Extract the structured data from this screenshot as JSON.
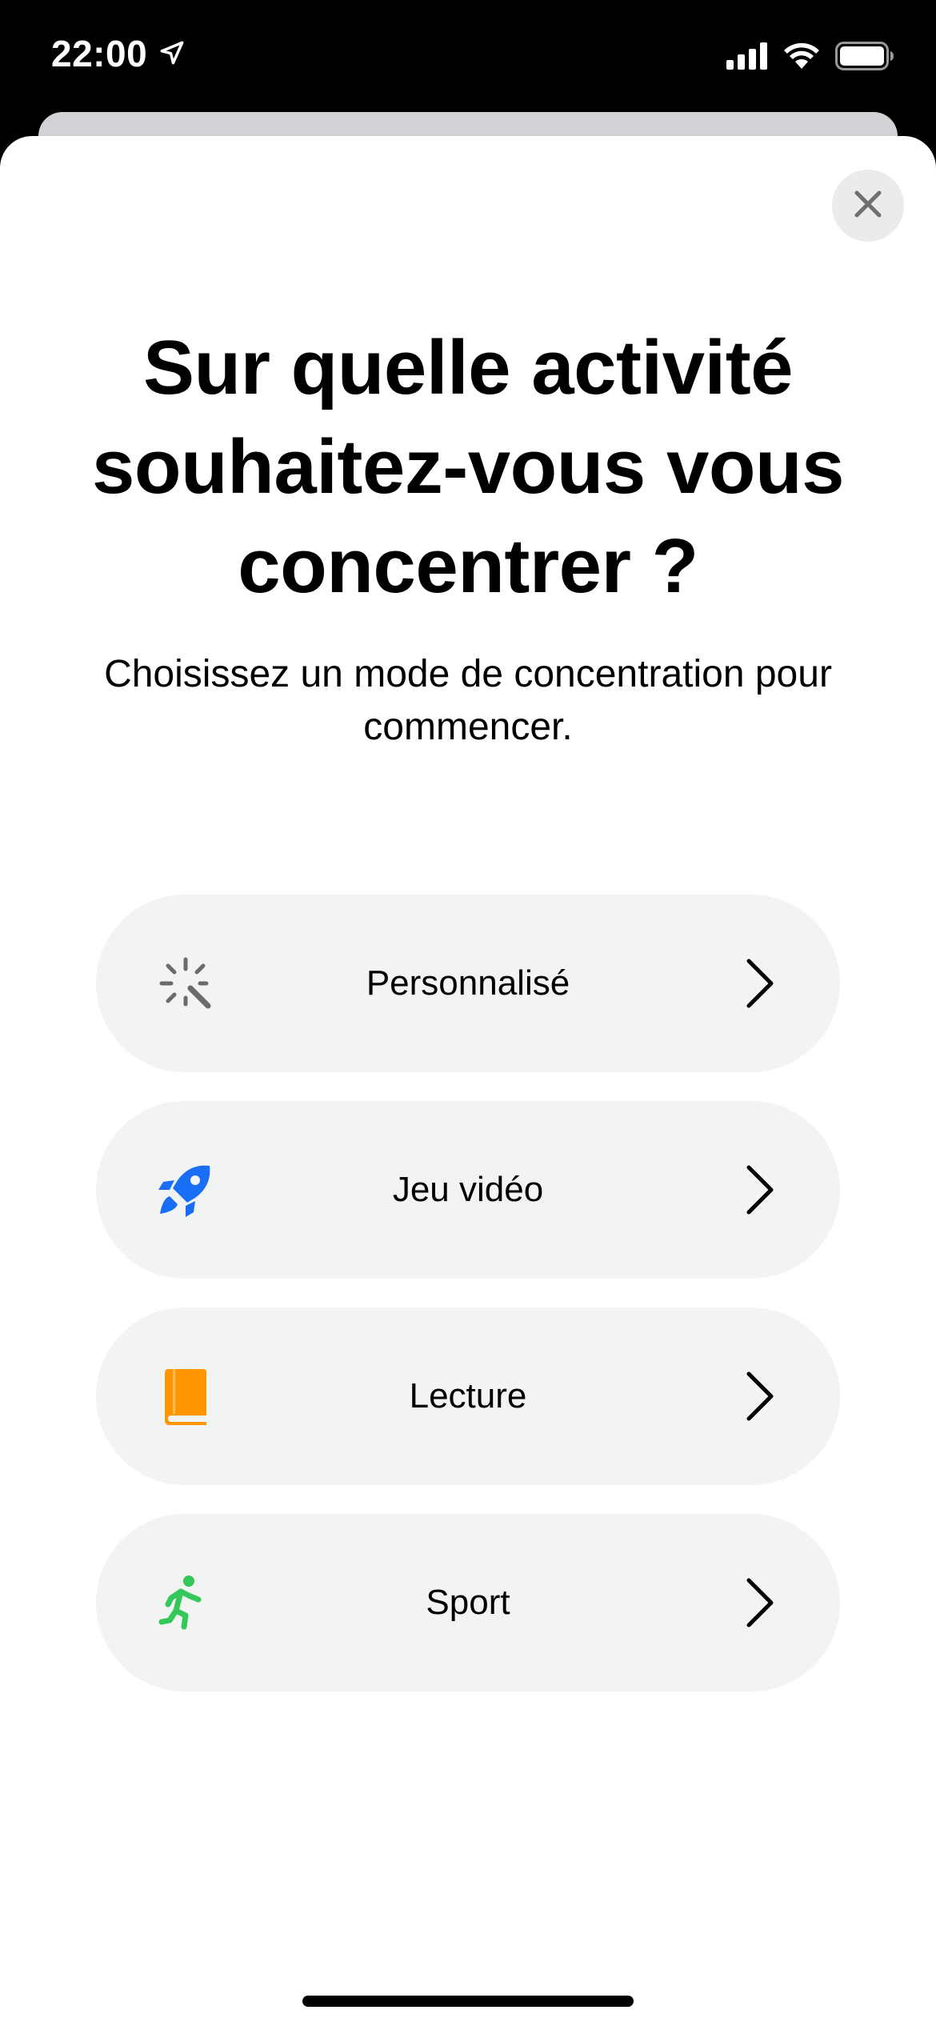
{
  "status_bar": {
    "time": "22:00",
    "location_icon": "location-arrow-icon",
    "signal_icon": "cellular-signal-icon",
    "wifi_icon": "wifi-icon",
    "battery_icon": "battery-icon"
  },
  "sheet": {
    "close_icon": "close-icon",
    "title": "Sur quelle activité souhaitez-vous vous concentrer ?",
    "subtitle": "Choisissez un mode de concentration pour commencer."
  },
  "options": [
    {
      "label": "Personnalisé",
      "icon": "magic-wand-icon",
      "icon_color": "#6b6b6b"
    },
    {
      "label": "Jeu vidéo",
      "icon": "rocket-icon",
      "icon_color": "#1a6ef5"
    },
    {
      "label": "Lecture",
      "icon": "book-icon",
      "icon_color": "#ff9500"
    },
    {
      "label": "Sport",
      "icon": "running-figure-icon",
      "icon_color": "#34c759"
    }
  ],
  "colors": {
    "option_background": "#f2f3f3",
    "close_button_background": "#ebebeb"
  }
}
